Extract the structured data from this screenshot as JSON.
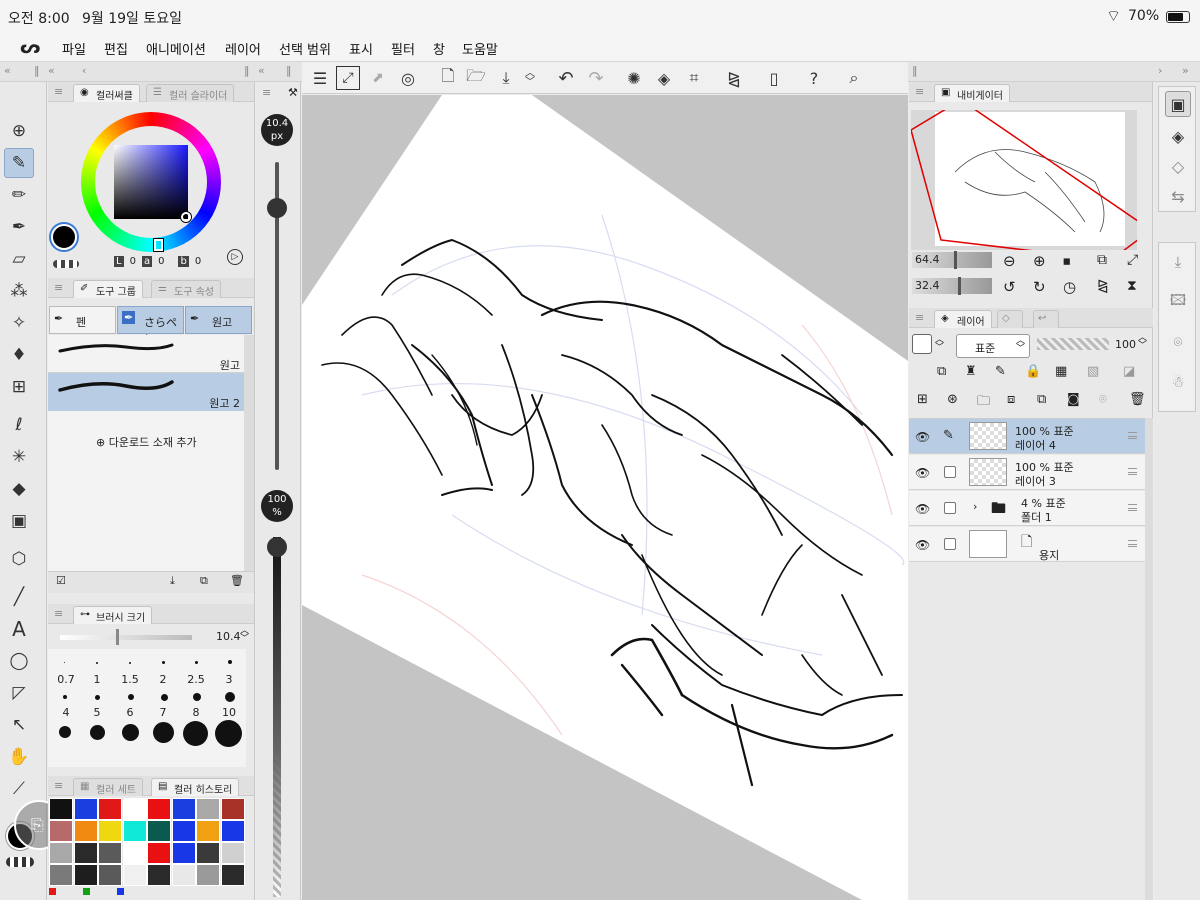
{
  "status": {
    "time": "오전 8:00",
    "date": "9월 19일 토요일",
    "battery": "70%"
  },
  "menu": [
    "파일",
    "편집",
    "애니메이션",
    "레이어",
    "선택 범위",
    "표시",
    "필터",
    "창",
    "도움말"
  ],
  "color_panel": {
    "tab_wheel": "컬러써클",
    "tab_slider": "컬러 슬라이더",
    "l_label": "L",
    "l_val": "0",
    "a_label": "a",
    "a_val": "0",
    "b_label": "b",
    "b_val": "0",
    "main_color": "#000000"
  },
  "tool_group": {
    "tab_group": "도구 그룹",
    "tab_prop": "도구 속성",
    "sub_tools": [
      "펜",
      "さらペン",
      "원고"
    ],
    "brushes": [
      "원고",
      "원고 2"
    ],
    "add_material": "다운로드 소재 추가"
  },
  "brush_size": {
    "title": "브러시 크기",
    "value": "10.4",
    "presets": [
      "0.7",
      "1",
      "1.5",
      "2",
      "2.5",
      "3",
      "4",
      "5",
      "6",
      "7",
      "8",
      "10",
      "",
      "",
      "",
      "",
      "",
      ""
    ]
  },
  "color_set": {
    "tab_set": "컬러 세트",
    "tab_history": "컬러 히스토리",
    "swatches": [
      "#111111",
      "#1a3fe0",
      "#e01818",
      "#ffffff",
      "#e81010",
      "#1a3fe0",
      "#a8a8a8",
      "#a83228",
      "#b86a6a",
      "#f08a10",
      "#f0d810",
      "#10e8d8",
      "#0a5a50",
      "#1838e8",
      "#f0a010",
      "#1838e8",
      "#a8a8a8",
      "#2a2a2a",
      "#5a5a5a",
      "#ffffff",
      "#e81010",
      "#1838e8",
      "#3a3a3a",
      "#d0d0d0",
      "#7a7a7a",
      "#1e1e1e",
      "#5a5a5a",
      "#f0f0f0",
      "#2a2a2a",
      "#e8e8e8",
      "#9a9a9a",
      "#2a2a2a"
    ]
  },
  "size_slider": {
    "size": "10.4",
    "size_unit": "px",
    "opacity": "100",
    "opacity_unit": "%",
    "size_fraction": 0.85,
    "opacity_fraction": 1.0
  },
  "navigator": {
    "title": "내비게이터",
    "zoom": "64.4",
    "angle": "32.4",
    "zoom_fraction": 0.52,
    "angle_fraction": 0.57
  },
  "layers": {
    "title": "레이어",
    "blend": "표준",
    "opacity": "100",
    "items": [
      {
        "pct": "100 %  표준",
        "name": "레이어 4",
        "selected": true
      },
      {
        "pct": "100 %  표준",
        "name": "레이어 3",
        "selected": false
      },
      {
        "pct": "4 %  표준",
        "name": "폴더 1",
        "selected": false
      },
      {
        "pct": "",
        "name": "용지",
        "selected": false
      }
    ]
  },
  "colors": {
    "accent": "#b8cde3",
    "selected_tool": "#b8cde3",
    "nav_frame": "#e00000"
  }
}
